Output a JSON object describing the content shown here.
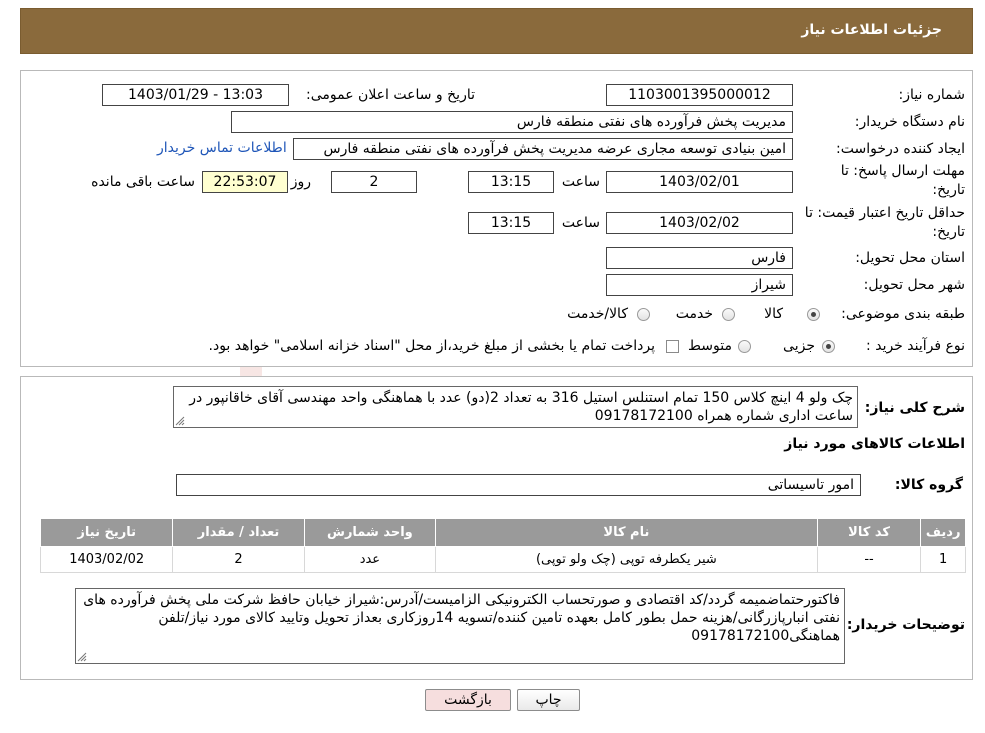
{
  "header": {
    "title": "جزئیات اطلاعات نیاز"
  },
  "form": {
    "need_number": {
      "label": "شماره نیاز:",
      "value": "1103001395000012"
    },
    "announce": {
      "label": "تاریخ و ساعت اعلان عمومی:",
      "value": "1403/01/29 - 13:03"
    },
    "buyer_org": {
      "label": "نام دستگاه خریدار:",
      "value": "مدیریت پخش فرآورده های نفتی منطقه فارس"
    },
    "requester": {
      "label": "ایجاد کننده درخواست:",
      "value": "امین بنیادی توسعه مجاری عرضه مدیریت پخش فرآورده های نفتی منطقه فارس",
      "contact_link": "اطلاعات تماس خریدار"
    },
    "reply_deadline": {
      "label_line1": "مهلت ارسال پاسخ: تا",
      "label_line2": "تاریخ:",
      "date": "1403/02/01",
      "time_label": "ساعت",
      "time": "13:15",
      "days": "2",
      "days_label": "روز و",
      "remaining": "22:53:07",
      "remaining_label": "ساعت باقی مانده"
    },
    "price_validity": {
      "label_line1": "حداقل تاریخ اعتبار قیمت: تا",
      "label_line2": "تاریخ:",
      "date": "1403/02/02",
      "time_label": "ساعت",
      "time": "13:15"
    },
    "province": {
      "label": "استان محل تحویل:",
      "value": "فارس"
    },
    "city": {
      "label": "شهر محل تحویل:",
      "value": "شیراز"
    },
    "category": {
      "label": "طبقه بندی موضوعی:",
      "options": [
        "کالا",
        "خدمت",
        "کالا/خدمت"
      ],
      "selected_index": 0
    },
    "purchase_type": {
      "label": "نوع فرآیند خرید :",
      "options": [
        "جزیی",
        "متوسط"
      ],
      "selected_index": 0,
      "note": "پرداخت تمام یا بخشی از مبلغ خرید،از محل \"اسناد خزانه اسلامی\" خواهد بود."
    }
  },
  "description": {
    "label": "شرح کلی نیاز:",
    "text": "چک ولو 4 اینچ کلاس 150  تمام استنلس استیل 316 به تعداد 2(دو) عدد با هماهنگی واحد مهندسی آقای خاقانپور در ساعت اداری شماره همراه 09178172100"
  },
  "goods": {
    "section_title": "اطلاعات کالاهای مورد نیاز",
    "group_label": "گروه کالا:",
    "group_value": "امور تاسیساتی",
    "table": {
      "headers": [
        "ردیف",
        "کد کالا",
        "نام کالا",
        "واحد شمارش",
        "تعداد / مقدار",
        "تاریخ نیاز"
      ],
      "rows": [
        [
          "1",
          "--",
          "شیر یکطرفه توپی (چک ولو توپی)",
          "عدد",
          "2",
          "1403/02/02"
        ]
      ]
    }
  },
  "buyer_notes": {
    "label": "توضیحات خریدار:",
    "text": "فاکتورحتماضمیمه گردد/کد اقتصادی و صورتحساب الکترونیکی الزامیست/آدرس:شیراز خیابان حافظ شرکت ملی پخش فرآورده های نفتی انبارپازرگانی/هزینه حمل بطور کامل بعهده تامین کننده/تسویه 14روزکاری بعداز تحویل وتایید کالای مورد نیاز/تلفن هماهنگی09178172100"
  },
  "buttons": {
    "print": "چاپ",
    "back": "بازگشت"
  },
  "watermark": {
    "text": "AriaTender.neT"
  },
  "colors": {
    "header_bg": "#8a6a3c",
    "table_header_bg": "#9a9a9a",
    "link": "#1f56b8",
    "back_btn_bg": "#f6dede"
  }
}
